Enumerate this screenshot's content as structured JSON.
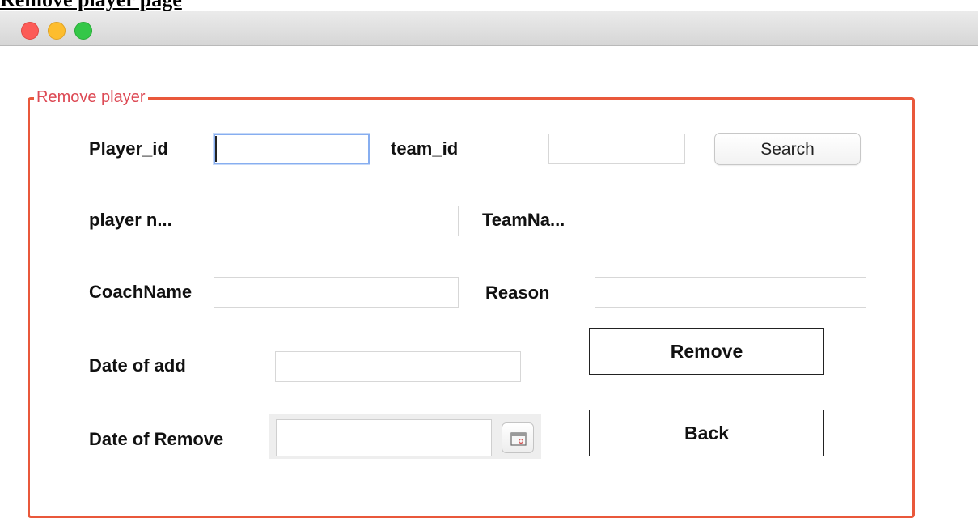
{
  "document": {
    "heading": "Remove player page"
  },
  "window": {
    "controls": [
      "close",
      "minimize",
      "maximize"
    ]
  },
  "form": {
    "group_title": "Remove player",
    "fields": {
      "player_id": {
        "label": "Player_id",
        "value": ""
      },
      "team_id": {
        "label": "team_id",
        "value": ""
      },
      "player_name": {
        "label": "player n...",
        "value": ""
      },
      "team_name": {
        "label": "TeamNa...",
        "value": ""
      },
      "coach_name": {
        "label": "CoachName",
        "value": ""
      },
      "reason": {
        "label": "Reason",
        "value": ""
      },
      "date_of_add": {
        "label": "Date of add",
        "value": ""
      },
      "date_of_remove": {
        "label": "Date of Remove",
        "value": ""
      }
    },
    "buttons": {
      "search": "Search",
      "remove": "Remove",
      "back": "Back"
    }
  },
  "icons": {
    "date_picker": "calendar-icon"
  },
  "colors": {
    "group_border": "#e9583b",
    "group_title": "#dd4a55",
    "focus_ring": "#87aef0"
  }
}
